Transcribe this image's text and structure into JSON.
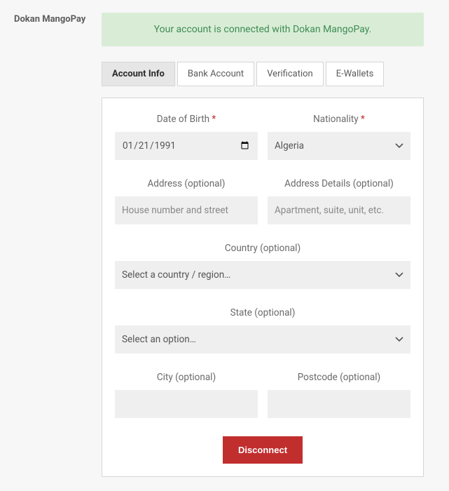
{
  "page_title": "Dokan MangoPay",
  "alert": "Your account is connected with Dokan MangoPay.",
  "tabs": {
    "account_info": "Account Info",
    "bank_account": "Bank Account",
    "verification": "Verification",
    "ewallets": "E-Wallets"
  },
  "form": {
    "dob": {
      "label": "Date of Birth",
      "value": "1991-01-21"
    },
    "nationality": {
      "label": "Nationality",
      "value": "Algeria"
    },
    "address": {
      "label": "Address (optional)",
      "placeholder": "House number and street"
    },
    "address_details": {
      "label": "Address Details (optional)",
      "placeholder": "Apartment, suite, unit, etc."
    },
    "country": {
      "label": "Country (optional)",
      "placeholder": "Select a country / region…"
    },
    "state": {
      "label": "State (optional)",
      "placeholder": "Select an option…"
    },
    "city": {
      "label": "City (optional)",
      "value": ""
    },
    "postcode": {
      "label": "Postcode (optional)",
      "value": ""
    }
  },
  "disconnect_label": "Disconnect",
  "required_mark": "*"
}
